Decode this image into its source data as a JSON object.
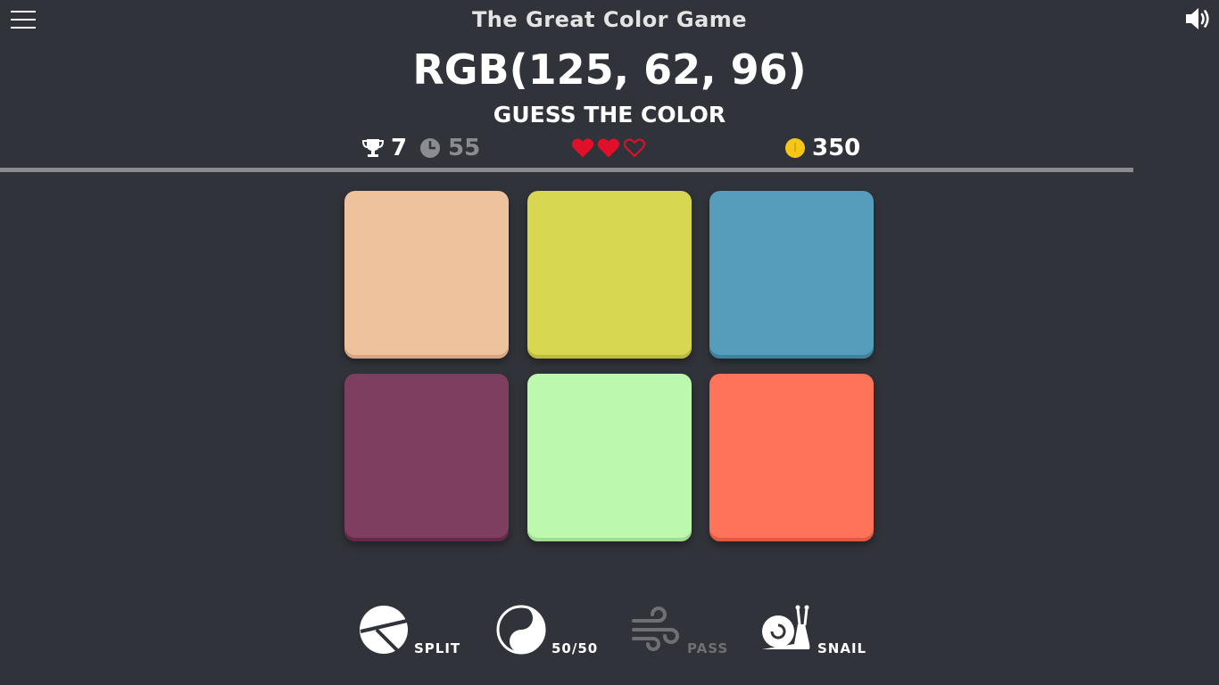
{
  "header": {
    "app_title": "The Great Color Game",
    "menu_icon": "hamburger-menu-icon",
    "sound_icon": "speaker-volume-icon"
  },
  "target": {
    "rgb_text": "RGB(125, 62, 96)",
    "instruction": "GUESS THE COLOR"
  },
  "stats": {
    "score": "7",
    "score_icon": "trophy-icon",
    "timer": "55",
    "timer_icon": "clock-icon",
    "lives": {
      "total": 3,
      "filled": 2,
      "icon": "heart-icon",
      "color": "#e0102a"
    },
    "coins": "350",
    "coins_icon": "coin-icon",
    "coin_color": "#f5c518"
  },
  "progress": {
    "fraction": 0.93
  },
  "swatches": [
    {
      "color": "#efc29e",
      "shade": "#d6a684"
    },
    {
      "color": "#d8d752",
      "shade": "#bcbb3c"
    },
    {
      "color": "#559dbb",
      "shade": "#3d829f"
    },
    {
      "color": "#7d3e60",
      "shade": "#62294a"
    },
    {
      "color": "#bcf8ae",
      "shade": "#9fdb92"
    },
    {
      "color": "#ff735a",
      "shade": "#e05a42"
    }
  ],
  "powerups": [
    {
      "label": "SPLIT",
      "icon": "split-icon",
      "enabled": true
    },
    {
      "label": "50/50",
      "icon": "yin-yang-icon",
      "enabled": true
    },
    {
      "label": "PASS",
      "icon": "wind-icon",
      "enabled": false
    },
    {
      "label": "SNAIL",
      "icon": "snail-icon",
      "enabled": true
    }
  ],
  "colors": {
    "background": "#31333a",
    "text": "#ffffff",
    "muted": "#8a8c92",
    "progress": "#8a8b8e"
  }
}
